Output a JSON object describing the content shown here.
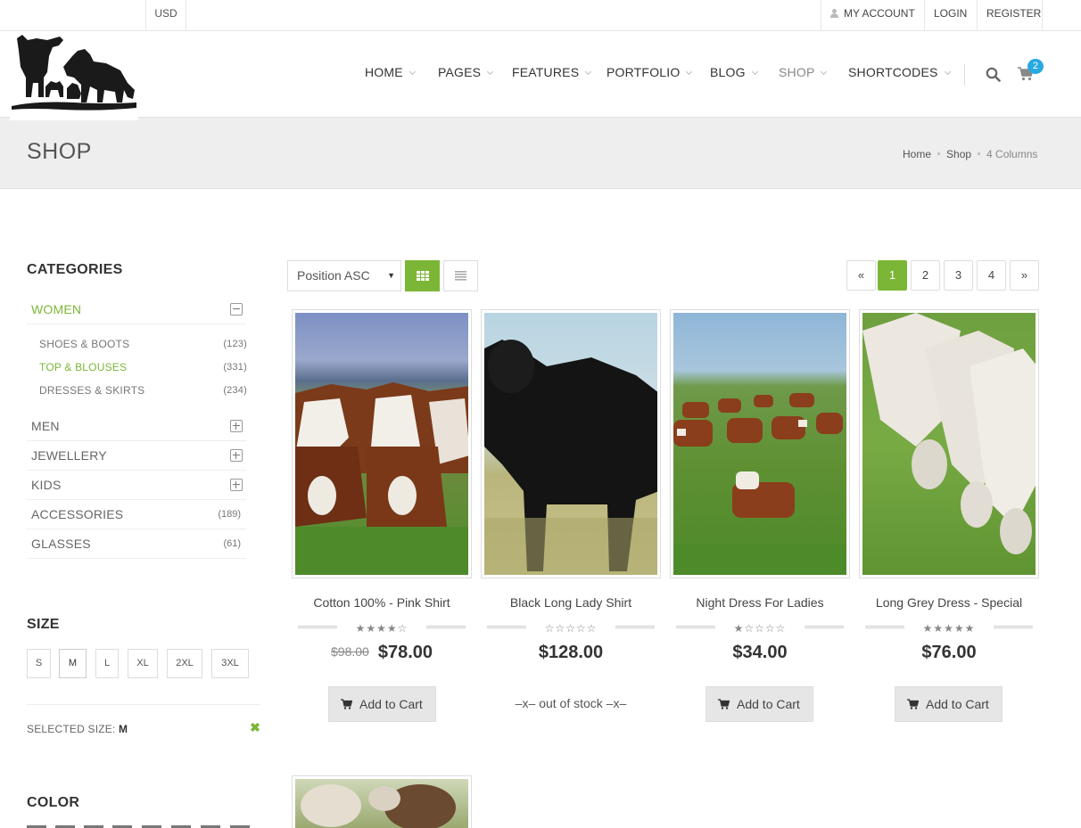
{
  "topbar": {
    "currency": "USD",
    "my_account": "MY ACCOUNT",
    "login": "LOGIN",
    "register": "REGISTER"
  },
  "nav": {
    "items": [
      {
        "label": "HOME"
      },
      {
        "label": "PAGES"
      },
      {
        "label": "FEATURES"
      },
      {
        "label": "PORTFOLIO"
      },
      {
        "label": "BLOG"
      },
      {
        "label": "SHOP",
        "active": true
      },
      {
        "label": "SHORTCODES"
      }
    ],
    "cart_count": "2"
  },
  "page": {
    "title": "SHOP"
  },
  "breadcrumb": {
    "home": "Home",
    "shop": "Shop",
    "current": "4 Columns"
  },
  "sidebar": {
    "categories_heading": "CATEGORIES",
    "categories": [
      {
        "label": "WOMEN",
        "state": "expanded"
      },
      {
        "label": "MEN",
        "state": "collapsed"
      },
      {
        "label": "JEWELLERY",
        "state": "collapsed"
      },
      {
        "label": "KIDS",
        "state": "collapsed"
      },
      {
        "label": "ACCESSORIES",
        "count": "(189)"
      },
      {
        "label": "GLASSES",
        "count": "(61)"
      }
    ],
    "women_sub": [
      {
        "label": "SHOES & BOOTS",
        "count": "(123)"
      },
      {
        "label": "TOP & BLOUSES",
        "count": "(331)"
      },
      {
        "label": "DRESSES & SKIRTS",
        "count": "(234)"
      }
    ],
    "size_heading": "SIZE",
    "sizes": [
      "S",
      "M",
      "L",
      "XL",
      "2XL",
      "3XL"
    ],
    "selected_size_label": "SELECTED SIZE:",
    "selected_size_value": "M",
    "color_heading": "COLOR"
  },
  "toolbar": {
    "sort_value": "Position ASC",
    "pagination": {
      "prev": "«",
      "pages": [
        "1",
        "2",
        "3",
        "4"
      ],
      "next": "»",
      "current": "1"
    }
  },
  "products": [
    {
      "name": "Cotton 100% - Pink Shirt",
      "rating": 4,
      "old_price": "$98.00",
      "price": "$78.00",
      "action": "Add to Cart"
    },
    {
      "name": "Black Long Lady Shirt",
      "rating": 0,
      "price": "$128.00",
      "stock_status": "–x– out of stock –x–"
    },
    {
      "name": "Night Dress For Ladies",
      "rating": 1,
      "price": "$34.00",
      "action": "Add to Cart"
    },
    {
      "name": "Long Grey Dress - Special",
      "rating": 5,
      "price": "$76.00",
      "action": "Add to Cart"
    }
  ],
  "colors": {
    "accent": "#7cb637",
    "badge": "#27a9e1",
    "text": "#555555"
  },
  "icons": [
    "user-icon",
    "search-icon",
    "cart-icon",
    "grid-view-icon",
    "list-view-icon",
    "minus-toggle-icon",
    "plus-toggle-icon",
    "clear-icon",
    "star-icon"
  ]
}
